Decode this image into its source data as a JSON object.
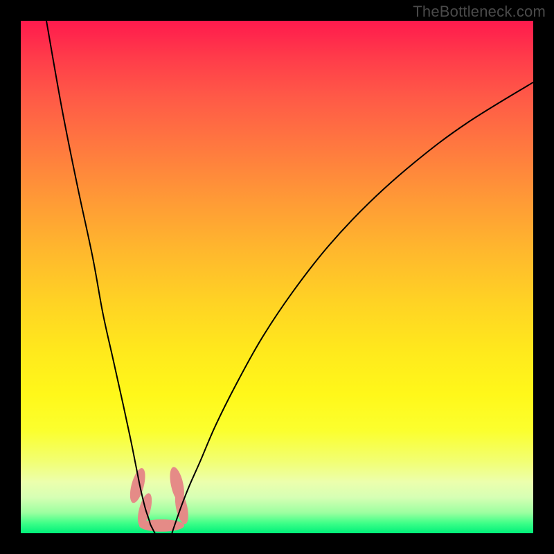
{
  "watermark": "TheBottleneck.com",
  "chart_data": {
    "type": "line",
    "title": "",
    "xlabel": "",
    "ylabel": "",
    "xlim": [
      0,
      100
    ],
    "ylim": [
      0,
      100
    ],
    "grid": false,
    "legend": false,
    "series": [
      {
        "name": "left-curve",
        "x": [
          5,
          8,
          11,
          14,
          16,
          18,
          20,
          21.5,
          22.5,
          23.3,
          24,
          24.4,
          24.8,
          25.1,
          25.3,
          25.6,
          25.9,
          26.2
        ],
        "y": [
          100,
          83,
          68,
          54,
          43,
          34,
          25,
          18,
          13,
          9,
          6,
          4.5,
          3.3,
          2.4,
          1.7,
          1.1,
          0.5,
          0
        ]
      },
      {
        "name": "right-curve",
        "x": [
          29.5,
          30,
          30.7,
          31.6,
          33,
          35,
          38,
          42,
          47,
          53,
          60,
          68,
          77,
          87,
          100
        ],
        "y": [
          0,
          1.5,
          3.5,
          6,
          9.5,
          14,
          21,
          29,
          38,
          47,
          56,
          64.5,
          72.5,
          80,
          88
        ]
      }
    ],
    "markers": [
      {
        "name": "lobe-left-upper",
        "cx": 22.8,
        "cy": 9.3,
        "rx": 1.2,
        "ry": 3.5,
        "rot": 15
      },
      {
        "name": "lobe-left-lower",
        "cx": 24.2,
        "cy": 4.6,
        "rx": 1.1,
        "ry": 3.3,
        "rot": 15
      },
      {
        "name": "lobe-right-upper",
        "cx": 30.5,
        "cy": 9.5,
        "rx": 1.2,
        "ry": 3.5,
        "rot": -12
      },
      {
        "name": "lobe-right-lower",
        "cx": 31.4,
        "cy": 5.0,
        "rx": 1.1,
        "ry": 3.3,
        "rot": -12
      },
      {
        "name": "lobe-bottom",
        "cx": 27.5,
        "cy": 1.5,
        "rx": 4.4,
        "ry": 1.2,
        "rot": 0
      }
    ]
  }
}
